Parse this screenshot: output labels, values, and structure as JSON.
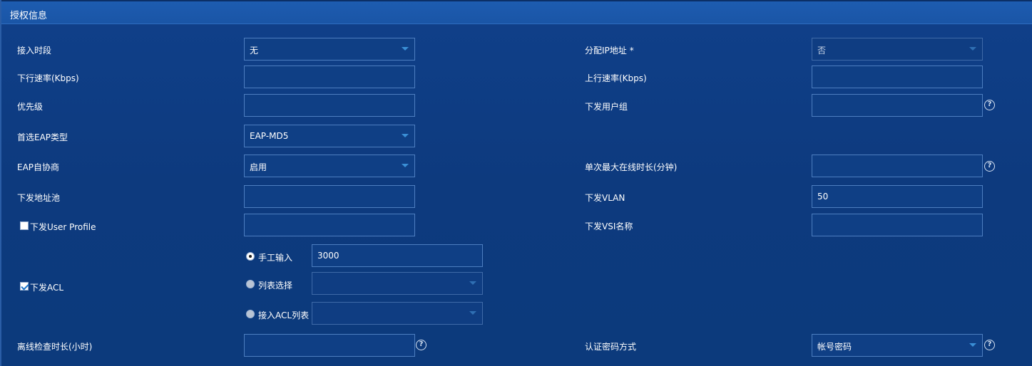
{
  "panel": {
    "title": "授权信息"
  },
  "rows": {
    "access_period": {
      "label": "接入时段",
      "value": "无"
    },
    "assign_ip": {
      "label": "分配IP地址",
      "required_mark": "*",
      "value": "否"
    },
    "down_rate": {
      "label": "下行速率(Kbps)",
      "value": ""
    },
    "up_rate": {
      "label": "上行速率(Kbps)",
      "value": ""
    },
    "priority": {
      "label": "优先级",
      "value": ""
    },
    "user_group": {
      "label": "下发用户组",
      "value": ""
    },
    "eap_type": {
      "label": "首选EAP类型",
      "value": "EAP-MD5"
    },
    "eap_negotiate": {
      "label": "EAP自协商",
      "value": "启用"
    },
    "max_online": {
      "label": "单次最大在线时长(分钟)",
      "value": ""
    },
    "address_pool": {
      "label": "下发地址池",
      "value": ""
    },
    "vlan": {
      "label": "下发VLAN",
      "value": "50"
    },
    "user_profile": {
      "label": "下发User Profile",
      "checked": false,
      "value": ""
    },
    "vsi_name": {
      "label": "下发VSI名称",
      "value": ""
    },
    "acl": {
      "label": "下发ACL",
      "checked": true,
      "options": [
        {
          "label": "手工输入",
          "selected": true,
          "value": "3000"
        },
        {
          "label": "列表选择",
          "selected": false,
          "value": ""
        },
        {
          "label": "接入ACL列表",
          "selected": false,
          "value": ""
        }
      ]
    },
    "offline_check": {
      "label": "离线检查时长(小时)",
      "value": ""
    },
    "auth_method": {
      "label": "认证密码方式",
      "value": "帐号密码"
    }
  },
  "icons": {
    "help": "question-circle-icon",
    "dropdown": "caret-down-icon"
  },
  "colors": {
    "header_bg": "#1a55a6",
    "panel_bg": "#0e3c80",
    "field_border": "#4d7ec0",
    "caret": "#3a8fd6"
  },
  "help_glyph": "?"
}
